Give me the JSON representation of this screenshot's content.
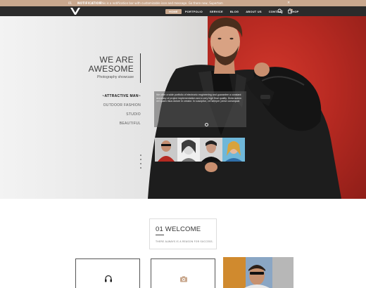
{
  "notification": {
    "number": "01",
    "tag": "NOTIFICATION",
    "message": "This is a notification bar with customizable icon and message. Go there now, Supertom",
    "close_icon": "close-icon"
  },
  "nav": {
    "items": [
      {
        "label": "HOME",
        "active": true
      },
      {
        "label": "PORTFOLIO",
        "active": false
      },
      {
        "label": "SERVICE",
        "active": false
      },
      {
        "label": "BLOG",
        "active": false
      },
      {
        "label": "ABOUT US",
        "active": false
      },
      {
        "label": "CONTACT",
        "active": false
      },
      {
        "label": "SHOP",
        "active": false
      }
    ],
    "search_icon": "search-icon",
    "cart_icon": "cart-icon"
  },
  "hero": {
    "headline_line1": "WE ARE",
    "headline_line2": "AWESOME",
    "subline": "Photography showcase",
    "categories": [
      {
        "label": "ATTRACTIVE MAN",
        "active": true
      },
      {
        "label": "OUTDOOR FASHION",
        "active": false
      },
      {
        "label": "STUDIO",
        "active": false
      },
      {
        "label": "BEAUTIFUL",
        "active": false
      }
    ],
    "overlay_text": "We offer a wide portfolio of electronic engineering and guarantee a constant accuracy of project implementation and a very high final quality. Dicta autem vel quam risus dolore in creator. In suscipitur, vel semper perse consequat."
  },
  "welcome": {
    "title": "01 WELCOME",
    "subtitle": "THERE ALWAYS IS A REASON FOR SUCCESS."
  },
  "colors": {
    "accent": "#c9a88e",
    "nav_bg": "#2b2b2b",
    "hero_red": "#c43026"
  }
}
